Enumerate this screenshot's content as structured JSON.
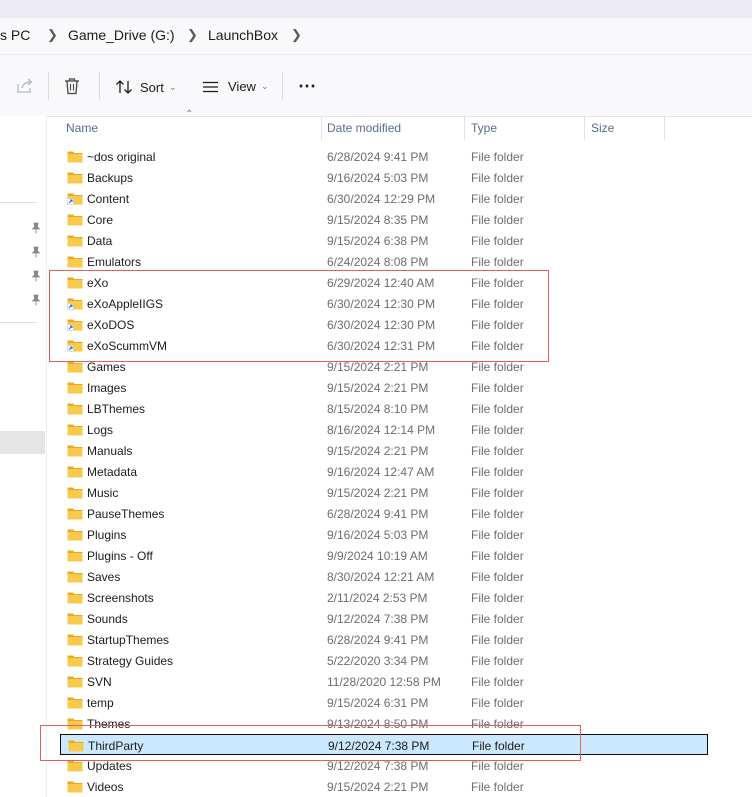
{
  "address_bar": {
    "crumbs": [
      "s PC",
      "Game_Drive (G:)",
      "LaunchBox"
    ]
  },
  "toolbar": {
    "sort_label": "Sort",
    "view_label": "View",
    "more_label": "⋯"
  },
  "columns": {
    "name": "Name",
    "date": "Date modified",
    "type": "Type",
    "size": "Size"
  },
  "files": [
    {
      "name": "~dos original",
      "date": "6/28/2024 9:41 PM",
      "type": "File folder",
      "shortcut": false
    },
    {
      "name": "Backups",
      "date": "9/16/2024 5:03 PM",
      "type": "File folder",
      "shortcut": false
    },
    {
      "name": "Content",
      "date": "6/30/2024 12:29 PM",
      "type": "File folder",
      "shortcut": true
    },
    {
      "name": "Core",
      "date": "9/15/2024 8:35 PM",
      "type": "File folder",
      "shortcut": false
    },
    {
      "name": "Data",
      "date": "9/15/2024 6:38 PM",
      "type": "File folder",
      "shortcut": false
    },
    {
      "name": "Emulators",
      "date": "6/24/2024 8:08 PM",
      "type": "File folder",
      "shortcut": false
    },
    {
      "name": "eXo",
      "date": "6/29/2024 12:40 AM",
      "type": "File folder",
      "shortcut": false
    },
    {
      "name": "eXoAppleIIGS",
      "date": "6/30/2024 12:30 PM",
      "type": "File folder",
      "shortcut": true
    },
    {
      "name": "eXoDOS",
      "date": "6/30/2024 12:30 PM",
      "type": "File folder",
      "shortcut": true
    },
    {
      "name": "eXoScummVM",
      "date": "6/30/2024 12:31 PM",
      "type": "File folder",
      "shortcut": true
    },
    {
      "name": "Games",
      "date": "9/15/2024 2:21 PM",
      "type": "File folder",
      "shortcut": false
    },
    {
      "name": "Images",
      "date": "9/15/2024 2:21 PM",
      "type": "File folder",
      "shortcut": false
    },
    {
      "name": "LBThemes",
      "date": "8/15/2024 8:10 PM",
      "type": "File folder",
      "shortcut": false
    },
    {
      "name": "Logs",
      "date": "8/16/2024 12:14 PM",
      "type": "File folder",
      "shortcut": false
    },
    {
      "name": "Manuals",
      "date": "9/15/2024 2:21 PM",
      "type": "File folder",
      "shortcut": false
    },
    {
      "name": "Metadata",
      "date": "9/16/2024 12:47 AM",
      "type": "File folder",
      "shortcut": false
    },
    {
      "name": "Music",
      "date": "9/15/2024 2:21 PM",
      "type": "File folder",
      "shortcut": false
    },
    {
      "name": "PauseThemes",
      "date": "6/28/2024 9:41 PM",
      "type": "File folder",
      "shortcut": false
    },
    {
      "name": "Plugins",
      "date": "9/16/2024 5:03 PM",
      "type": "File folder",
      "shortcut": false
    },
    {
      "name": "Plugins - Off",
      "date": "9/9/2024 10:19 AM",
      "type": "File folder",
      "shortcut": false
    },
    {
      "name": "Saves",
      "date": "8/30/2024 12:21 AM",
      "type": "File folder",
      "shortcut": false
    },
    {
      "name": "Screenshots",
      "date": "2/11/2024 2:53 PM",
      "type": "File folder",
      "shortcut": false
    },
    {
      "name": "Sounds",
      "date": "9/12/2024 7:38 PM",
      "type": "File folder",
      "shortcut": false
    },
    {
      "name": "StartupThemes",
      "date": "6/28/2024 9:41 PM",
      "type": "File folder",
      "shortcut": false
    },
    {
      "name": "Strategy Guides",
      "date": "5/22/2020 3:34 PM",
      "type": "File folder",
      "shortcut": false
    },
    {
      "name": "SVN",
      "date": "11/28/2020 12:58 PM",
      "type": "File folder",
      "shortcut": false
    },
    {
      "name": "temp",
      "date": "9/15/2024 6:31 PM",
      "type": "File folder",
      "shortcut": false
    },
    {
      "name": "Themes",
      "date": "9/13/2024 8:50 PM",
      "type": "File folder",
      "shortcut": false
    },
    {
      "name": "ThirdParty",
      "date": "9/12/2024 7:38 PM",
      "type": "File folder",
      "shortcut": false,
      "selected": true
    },
    {
      "name": "Updates",
      "date": "9/12/2024 7:38 PM",
      "type": "File folder",
      "shortcut": false
    },
    {
      "name": "Videos",
      "date": "9/15/2024 2:21 PM",
      "type": "File folder",
      "shortcut": false
    }
  ],
  "colors": {
    "selection_fill": "#cce8ff",
    "highlight_box": "#e06060",
    "folder_yellow": "#f8c94a",
    "shortcut_arrow": "#2a6fd6"
  }
}
